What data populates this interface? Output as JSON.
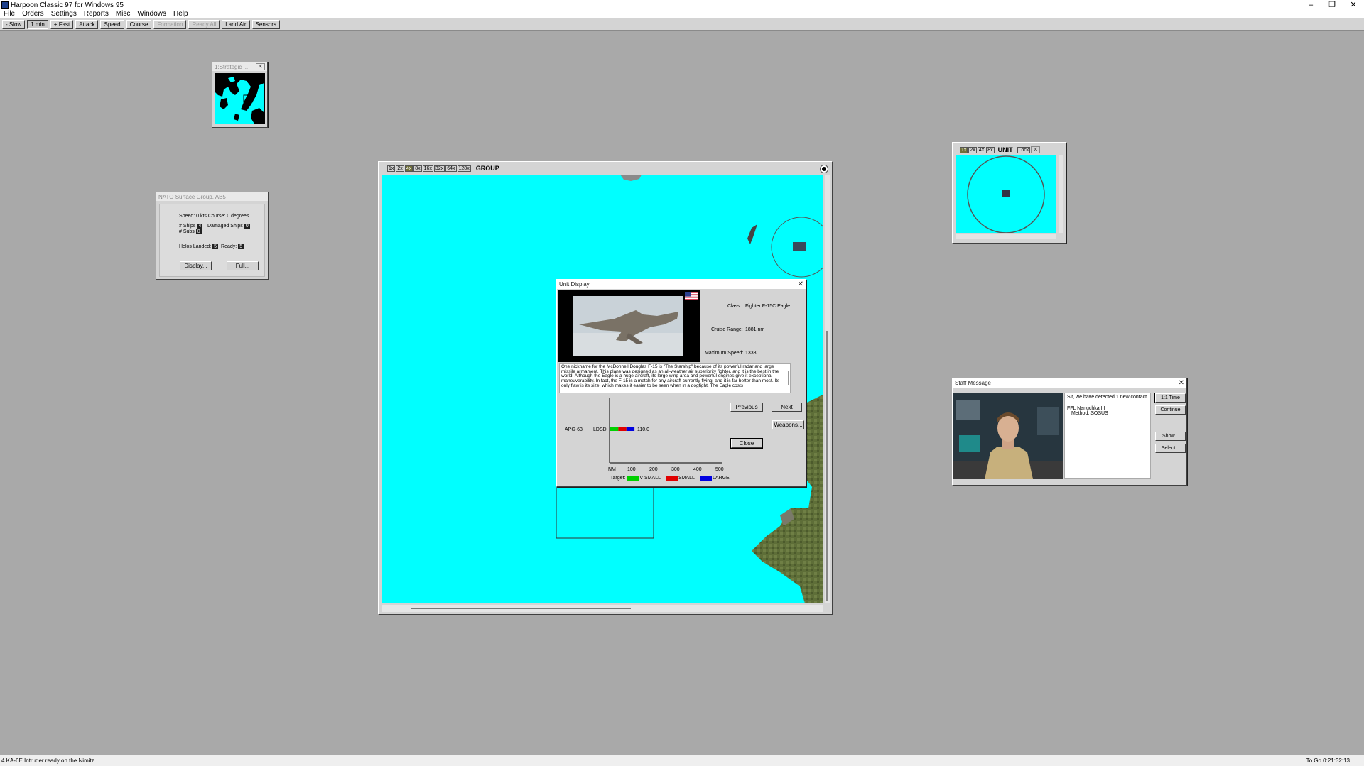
{
  "app": {
    "title": "Harpoon Classic 97 for Windows 95",
    "window_controls": {
      "minimize": "–",
      "restore": "❐",
      "close": "✕"
    }
  },
  "menu": [
    "File",
    "Orders",
    "Settings",
    "Reports",
    "Misc",
    "Windows",
    "Help"
  ],
  "toolbar": {
    "buttons": [
      {
        "label": "- Slow",
        "state": "normal"
      },
      {
        "label": "1 min",
        "state": "pressed"
      },
      {
        "label": "+ Fast",
        "state": "normal"
      },
      {
        "label": "Attack",
        "state": "normal"
      },
      {
        "label": "Speed",
        "state": "normal"
      },
      {
        "label": "Course",
        "state": "normal"
      },
      {
        "label": "Formation",
        "state": "disabled"
      },
      {
        "label": "Ready All",
        "state": "disabled"
      },
      {
        "label": "Land Air",
        "state": "normal"
      },
      {
        "label": "Sensors",
        "state": "normal"
      }
    ]
  },
  "strategic_window": {
    "title": "1:Strategic ..."
  },
  "group_info": {
    "title": "NATO Surface Group, AB5",
    "speed_course": "Speed: 0 kts   Course: 0 degrees",
    "ships_label": "# Ships",
    "ships_value": "4",
    "subs_label": "# Subs",
    "subs_value": "0",
    "damaged_label": "Damaged Ships",
    "damaged_value": "0",
    "helos_label": "Helos Landed:",
    "helos_value": "5",
    "ready_label": "Ready:",
    "ready_value": "5",
    "display_btn": "Display...",
    "full_btn": "Full..."
  },
  "group_window": {
    "zoom_buttons": [
      "1x",
      "2x",
      "4x",
      "8x",
      "16x",
      "32x",
      "64x",
      "128x"
    ],
    "active_zoom": "4x",
    "label": "GROUP",
    "colors": {
      "sea": "#00ffff",
      "land": "#5a6b34"
    }
  },
  "unit_window": {
    "zoom_buttons": [
      "1x",
      "2x",
      "4x",
      "8x"
    ],
    "active_zoom": "1x",
    "label": "UNIT",
    "lock": "Lock"
  },
  "unit_display": {
    "title": "Unit Display",
    "class_label": "Class:",
    "class_value": "Fighter F-15C Eagle",
    "range_label": "Cruise Range:",
    "range_value": "1881 nm",
    "speed_label": "Maximum Speed:",
    "speed_value": "1338",
    "description": "One nickname for the McDonnell Douglas F-15 is \"The Starship\" because of its powerful radar and large missile armament.  This plane was designed as an all-weather air superiority fighter, and it is the best in the world.  Although the Eagle is a huge aircraft, its large wing area and powerful engines give it exceptional maneuverability.  In fact, the F-15 is a match for any aircraft currently flying, and it is far better than most.  Its only flaw is its size, which makes it easier to be seen when in a dogfight.  The Eagle costs",
    "previous_btn": "Previous",
    "next_btn": "Next",
    "weapons_btn": "Weapons...",
    "close_btn": "Close",
    "sensor_name": "APG-63",
    "sensor_mode": "LDSD",
    "sensor_range": "110.0",
    "axis_label": "NM",
    "axis_ticks": [
      "100",
      "200",
      "300",
      "400",
      "500"
    ],
    "target_label": "Target:",
    "legend": [
      {
        "label": "V SMALL",
        "color": "#00d000"
      },
      {
        "label": "SMALL",
        "color": "#e00000"
      },
      {
        "label": "LARGE",
        "color": "#0000e0"
      }
    ]
  },
  "staff_message": {
    "title": "Staff Message",
    "line1": "Sir, we have detected 1 new contact.",
    "line2": "FFL Nanuchka III",
    "line3": "Method: SOSUS",
    "btn_time": "1:1 Time",
    "btn_continue": "Continue",
    "btn_show": "Show...",
    "btn_select": "Select..."
  },
  "status": {
    "left": "4 KA-6E Intruder ready on the Nimitz",
    "right": "To Go 0:21:32:13"
  }
}
